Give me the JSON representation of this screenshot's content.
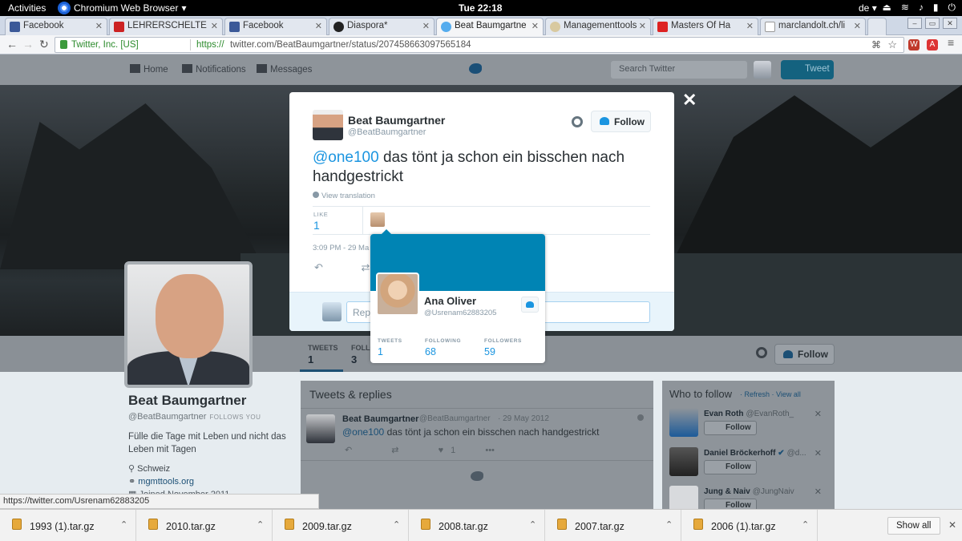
{
  "gnome": {
    "activities": "Activities",
    "app_name": "Chromium Web Browser",
    "clock": "Tue 22:18",
    "lang": "de"
  },
  "tabs": [
    {
      "label": "Facebook",
      "fav_color": "#3b5998"
    },
    {
      "label": "LEHRERSCHELTE",
      "fav_color": "#cc2222"
    },
    {
      "label": "Facebook",
      "fav_color": "#3b5998"
    },
    {
      "label": "Diaspora*",
      "fav_color": "#222222"
    },
    {
      "label": "Beat Baumgartne",
      "fav_color": "#55acee"
    },
    {
      "label": "Managementtools",
      "fav_color": "#d8c9a0"
    },
    {
      "label": "Masters Of Ha",
      "fav_color": "#dd2222"
    },
    {
      "label": "marclandolt.ch/li",
      "fav_color": "#999999"
    }
  ],
  "omnibox": {
    "org": "Twitter, Inc. [US]",
    "scheme": "https://",
    "url": "twitter.com/BeatBaumgartner/status/207458663097565184"
  },
  "twitter_nav": {
    "home": "Home",
    "notifications": "Notifications",
    "messages": "Messages",
    "search_placeholder": "Search Twitter",
    "tweet_button": "Tweet"
  },
  "profile": {
    "name": "Beat Baumgartner",
    "handle": "@BeatBaumgartner",
    "follows_you": "FOLLOWS YOU",
    "bio": "Fülle die Tage mit Leben und nicht das Leben mit Tagen",
    "location": "Schweiz",
    "website": "mgmttools.org",
    "joined": "Joined November 2011",
    "follow_label": "Follow"
  },
  "profile_nav": {
    "tweets_label": "TWEETS",
    "tweets_value": "1",
    "following_label": "FOLLO",
    "following_value": "3"
  },
  "modal": {
    "name": "Beat Baumgartner",
    "handle": "@BeatBaumgartner",
    "follow_label": "Follow",
    "mention": "@one100",
    "text": " das tönt ja schon ein bisschen nach handgestrickt",
    "translate": "View translation",
    "like_label": "LIKE",
    "like_value": "1",
    "date": "3:09 PM - 29 Ma",
    "reply_placeholder": "Repl"
  },
  "hovercard": {
    "name": "Ana Oliver",
    "handle": "@Usrenam62883205",
    "tweets_label": "TWEETS",
    "tweets_value": "1",
    "following_label": "FOLLOWING",
    "following_value": "68",
    "followers_label": "FOLLOWERS",
    "followers_value": "59",
    "banner_color": "#0084b4"
  },
  "timeline": {
    "header": "Tweets & replies",
    "tweet": {
      "name": "Beat Baumgartner",
      "handle": "@BeatBaumgartner",
      "date": "· 29 May 2012",
      "mention": "@one100",
      "text": " das tönt ja schon ein bisschen nach handgestrickt",
      "likes": "1"
    }
  },
  "who_to_follow": {
    "title": "Who to follow",
    "refresh": "· Refresh",
    "view_all": "· View all",
    "follow_label": "Follow",
    "people": [
      {
        "name": "Evan Roth",
        "handle": "@EvanRoth_"
      },
      {
        "name": "Daniel Bröckerhoff",
        "handle": "@d..."
      },
      {
        "name": "Jung & Naiv",
        "handle": "@JungNaiv"
      }
    ]
  },
  "status_url": "https://twitter.com/Usrenam62883205",
  "downloads": [
    {
      "file": "1993 (1).tar.gz"
    },
    {
      "file": "2010.tar.gz"
    },
    {
      "file": "2009.tar.gz"
    },
    {
      "file": "2008.tar.gz"
    },
    {
      "file": "2007.tar.gz"
    },
    {
      "file": "2006 (1).tar.gz"
    }
  ],
  "show_all": "Show all"
}
